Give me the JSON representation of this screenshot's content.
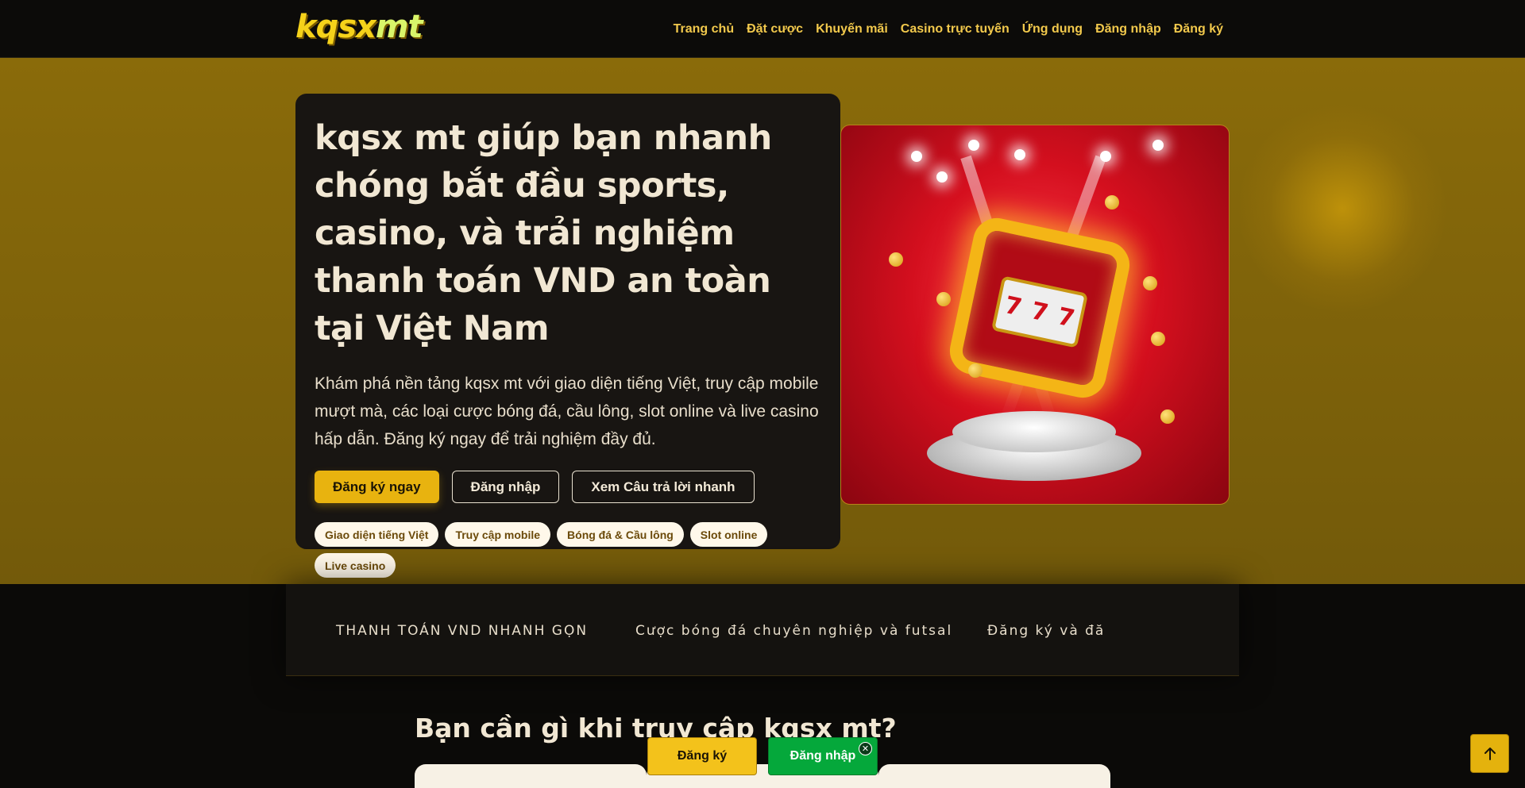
{
  "header": {
    "logo_main": "kqsx",
    "logo_accent": "mt",
    "nav": [
      "Trang chủ",
      "Đặt cược",
      "Khuyến mãi",
      "Casino trực tuyến",
      "Ứng dụng",
      "Đăng nhập",
      "Đăng ký"
    ]
  },
  "hero": {
    "title": "kqsx mt giúp bạn nhanh chóng bắt đầu sports, casino, và trải nghiệm thanh toán VND an toàn tại Việt Nam",
    "description": "Khám phá nền tảng kqsx mt với giao diện tiếng Việt, truy cập mobile mượt mà, các loại cược bóng đá, cầu lông, slot online và live casino hấp dẫn. Đăng ký ngay để trải nghiệm đầy đủ.",
    "buttons": {
      "register": "Đăng ký ngay",
      "login": "Đăng nhập",
      "faq": "Xem Câu trả lời nhanh"
    },
    "tags": [
      "Giao diện tiếng Việt",
      "Truy cập mobile",
      "Bóng đá & Cầu lông",
      "Slot online",
      "Live casino"
    ],
    "image_icon": "slot-machine-illustration",
    "reel_symbol": "7"
  },
  "marquee": {
    "items": [
      "THANH TOÁN VND NHANH GỌN",
      "Cược bóng đá chuyên nghiệp và futsal",
      "Đăng ký và đă"
    ]
  },
  "section": {
    "title": "Bạn cần gì khi truy cập kqsx mt?"
  },
  "sticky": {
    "register": "Đăng ký",
    "login": "Đăng nhập",
    "close_icon": "close-icon",
    "close_glyph": "✕"
  },
  "scroll_top": {
    "icon": "arrow-up-icon"
  },
  "colors": {
    "accent": "#e8b30f",
    "hero_bg": "#7d620a",
    "dark": "#181512",
    "login_green": "#05a83b"
  }
}
